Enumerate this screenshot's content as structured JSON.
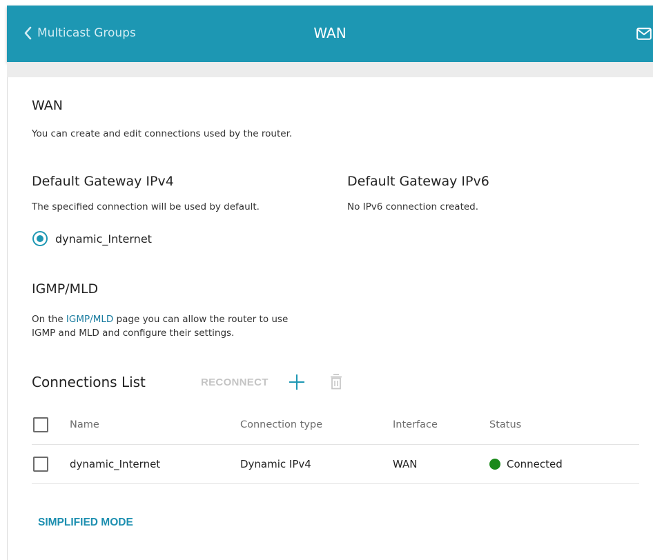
{
  "header": {
    "back_label": "Multicast Groups",
    "title": "WAN",
    "back_icon": "chevron-left-icon",
    "mail_icon": "envelope-icon"
  },
  "wan": {
    "heading": "WAN",
    "description": "You can create and edit connections used by the router."
  },
  "gateway_ipv4": {
    "heading": "Default Gateway IPv4",
    "description": "The specified connection will be used by default.",
    "selected_connection": "dynamic_Internet"
  },
  "gateway_ipv6": {
    "heading": "Default Gateway IPv6",
    "description": "No IPv6 connection created."
  },
  "igmp": {
    "heading": "IGMP/MLD",
    "text_before": "On the ",
    "link": "IGMP/MLD",
    "text_after": " page you can allow the router to use",
    "text_line2": "IGMP and MLD and configure their settings."
  },
  "connections": {
    "heading": "Connections List",
    "reconnect_label": "RECONNECT",
    "add_icon": "plus-icon",
    "delete_icon": "trash-icon",
    "columns": [
      "Name",
      "Connection type",
      "Interface",
      "Status"
    ],
    "rows": [
      {
        "name": "dynamic_Internet",
        "type": "Dynamic IPv4",
        "interface": "WAN",
        "status": "Connected",
        "status_color": "#1a8a1a"
      }
    ]
  },
  "footer": {
    "simplified_mode_label": "SIMPLIFIED MODE"
  },
  "colors": {
    "accent": "#1d97b3",
    "link": "#1a7ca0"
  }
}
